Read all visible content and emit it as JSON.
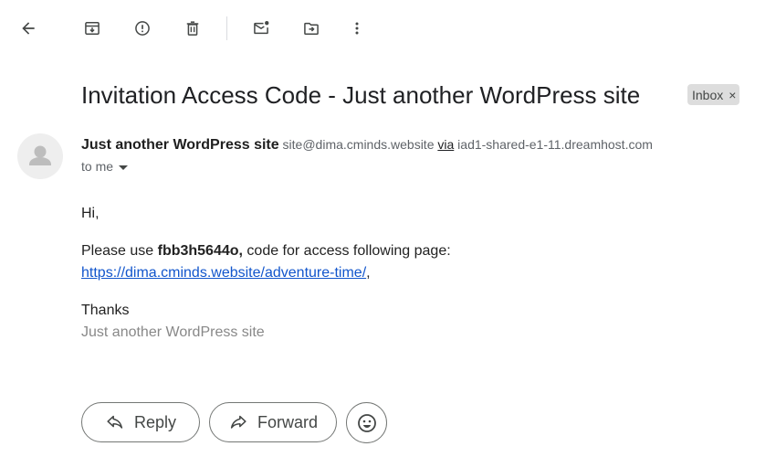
{
  "toolbar": {
    "items": [
      {
        "name": "back-button",
        "icon": "arrow-left-icon"
      },
      {
        "name": "archive-button",
        "icon": "archive-icon"
      },
      {
        "name": "report-spam-button",
        "icon": "report-icon"
      },
      {
        "name": "delete-button",
        "icon": "trash-icon"
      },
      {
        "name": "mark-unread-button",
        "icon": "mark-unread-icon"
      },
      {
        "name": "move-to-button",
        "icon": "move-to-folder-icon"
      },
      {
        "name": "more-button",
        "icon": "more-vert-icon"
      }
    ]
  },
  "email": {
    "subject": "Invitation Access Code - Just another WordPress site",
    "label": "Inbox",
    "label_remove": "×",
    "sender_name": "Just another WordPress site",
    "sender_email": "site@dima.cminds.website",
    "via": "via",
    "via_host": "iad1-shared-e1-11.dreamhost.com",
    "to": "to me",
    "body": {
      "greeting": "Hi,",
      "line1_prefix": "Please use ",
      "code": "fbb3h5644o,",
      "line1_suffix": " code for access following page:",
      "link": "https://dima.cminds.website/adventure-time/",
      "link_suffix": ",",
      "thanks": "Thanks",
      "signature": "Just another WordPress site"
    }
  },
  "actions": {
    "reply": "Reply",
    "forward": "Forward"
  },
  "colors": {
    "link": "#1155cc",
    "chip_bg": "#dddddd",
    "muted": "#5f6368"
  }
}
